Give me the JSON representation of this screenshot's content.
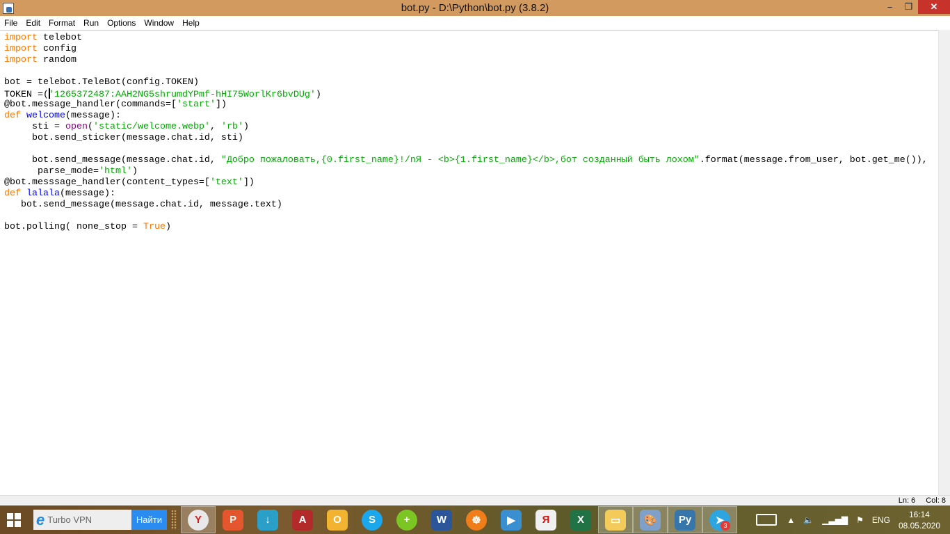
{
  "window": {
    "title": "bot.py - D:\\Python\\bot.py (3.8.2)",
    "minimize": "−",
    "maximize": "❐",
    "close": "✕"
  },
  "menu": [
    "File",
    "Edit",
    "Format",
    "Run",
    "Options",
    "Window",
    "Help"
  ],
  "code": [
    [
      [
        "kw",
        "import"
      ],
      [
        "",
        "telebot"
      ]
    ],
    [
      [
        "kw",
        "import"
      ],
      [
        "",
        "config"
      ]
    ],
    [
      [
        "kw",
        "import"
      ],
      [
        "",
        "random"
      ]
    ],
    [],
    [
      [
        "",
        "bot = telebot.TeleBot(config.TOKEN)"
      ]
    ],
    [
      [
        "",
        "TOKEN =("
      ],
      [
        "cursor",
        ""
      ],
      [
        "str",
        "'1265372487:AAH2NG5shrumdYPmf-hHI75WorlKr6bvDUg'"
      ],
      [
        "",
        ")"
      ]
    ],
    [
      [
        "",
        "@bot.message_handler(commands=["
      ],
      [
        "str",
        "'start'"
      ],
      [
        "",
        "])"
      ]
    ],
    [
      [
        "kw",
        "def"
      ],
      [
        "fn",
        "welcome"
      ],
      [
        "",
        "(message):"
      ]
    ],
    [
      [
        "",
        "     sti = "
      ],
      [
        "bi",
        "open"
      ],
      [
        "",
        "("
      ],
      [
        "str",
        "'static/welcome.webp'"
      ],
      [
        "",
        ", "
      ],
      [
        "str",
        "'rb'"
      ],
      [
        "",
        ")"
      ]
    ],
    [
      [
        "",
        "     bot.send_sticker(message.chat.id, sti)"
      ]
    ],
    [],
    [
      [
        "",
        "     bot.send_message(message.chat.id, "
      ],
      [
        "str",
        "\"Добро пожаловать,{0.first_name}!/nЯ - <b>{1.first_name}</b>,бот созданный быть лохом\""
      ],
      [
        "",
        ".format(message.from_user, bot.get_me()),"
      ]
    ],
    [
      [
        "",
        "      parse_mode="
      ],
      [
        "str",
        "'html'"
      ],
      [
        "",
        ")"
      ]
    ],
    [
      [
        "",
        "@bot.messsage_handler(content_types=["
      ],
      [
        "str",
        "'text'"
      ],
      [
        "",
        "])"
      ]
    ],
    [
      [
        "kw",
        "def"
      ],
      [
        "fn",
        "lalala"
      ],
      [
        "",
        "(message):"
      ]
    ],
    [
      [
        "",
        "   bot.send_message(message.chat.id, message.text)"
      ]
    ],
    [],
    [
      [
        "",
        "bot.polling( none_stop = "
      ],
      [
        "kw",
        "True"
      ],
      [
        "",
        ")"
      ]
    ]
  ],
  "status": {
    "line": "Ln: 6",
    "col": "Col: 8"
  },
  "taskbar": {
    "search_text": "Turbo VPN",
    "search_button": "Найти",
    "apps": [
      {
        "name": "yandex-browser",
        "glyph": "Y",
        "color": "#e8e8e8",
        "fg": "#d21a1a",
        "active": true
      },
      {
        "name": "powerpoint",
        "glyph": "P",
        "color": "#e4572e"
      },
      {
        "name": "download-manager",
        "glyph": "↓",
        "color": "#2aa0c8"
      },
      {
        "name": "access",
        "glyph": "A",
        "color": "#b22a2a"
      },
      {
        "name": "outlook",
        "glyph": "O",
        "color": "#f2b430"
      },
      {
        "name": "skype",
        "glyph": "S",
        "color": "#1aa7ec"
      },
      {
        "name": "360-security",
        "glyph": "+",
        "color": "#7cc623"
      },
      {
        "name": "word",
        "glyph": "W",
        "color": "#2b579a"
      },
      {
        "name": "helm-app",
        "glyph": "☸",
        "color": "#ef7d1a"
      },
      {
        "name": "media-player",
        "glyph": "▶",
        "color": "#3a8fd0"
      },
      {
        "name": "yandex",
        "glyph": "Я",
        "color": "#f0f0f0",
        "fg": "#e01010"
      },
      {
        "name": "excel",
        "glyph": "X",
        "color": "#217346"
      },
      {
        "name": "file-explorer",
        "glyph": "▭",
        "color": "#f2cb5a",
        "active": true
      },
      {
        "name": "paint",
        "glyph": "🎨",
        "color": "#7fa0c8",
        "active": true
      },
      {
        "name": "python-idle",
        "glyph": "Py",
        "color": "#3776ab",
        "active": true
      },
      {
        "name": "telegram",
        "glyph": "➤",
        "color": "#2ca5e0",
        "active": true,
        "badge": "3"
      }
    ],
    "language": "ENG",
    "time": "16:14",
    "date": "08.05.2020"
  }
}
